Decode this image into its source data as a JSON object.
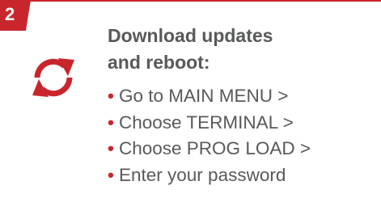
{
  "brand_color": "#c8262c",
  "text_color": "#58595b",
  "step": {
    "number": "2",
    "icon": "refresh-sync-icon",
    "heading_line1": "Download updates",
    "heading_line2": "and reboot:",
    "bullet_glyph": "•",
    "items": [
      "Go to MAIN MENU >",
      "Choose TERMINAL >",
      "Choose PROG LOAD >",
      "Enter your password"
    ]
  }
}
